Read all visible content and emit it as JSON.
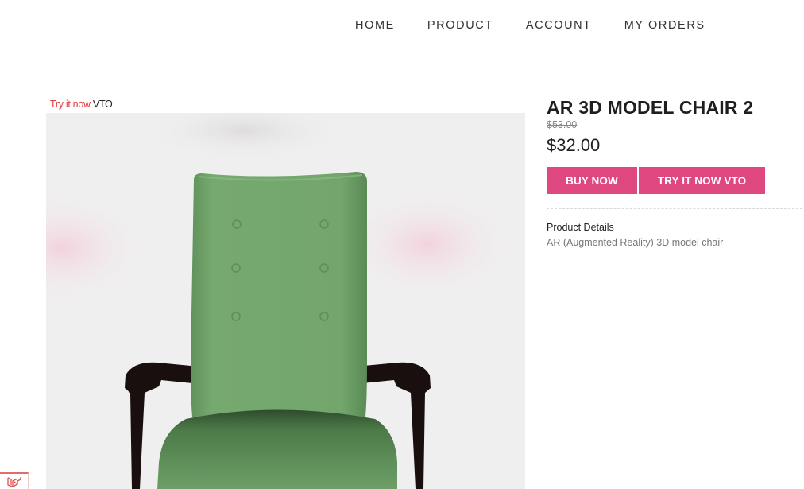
{
  "nav": {
    "items": [
      {
        "label": "HOME"
      },
      {
        "label": "PRODUCT"
      },
      {
        "label": "ACCOUNT"
      },
      {
        "label": "MY ORDERS"
      }
    ]
  },
  "viewer": {
    "try_link": "Try it now",
    "try_suffix": "VTO",
    "model_icon": "green-armchair-3d-model"
  },
  "product": {
    "title": "AR 3D MODEL CHAIR 2",
    "old_price": "$53.00",
    "price": "$32.00",
    "buy_label": "BUY NOW",
    "try_label": "TRY IT NOW VTO",
    "details_heading": "Product Details",
    "details_text": "AR (Augmented Reality) 3D model chair"
  },
  "colors": {
    "accent": "#df4781",
    "link_red": "#e23a3a",
    "chair_green": "#72a46c",
    "frame_dark": "#1a0f0f",
    "viewer_bg": "#f0eff0"
  },
  "footer": {
    "badge_icon": "laravel-icon"
  }
}
